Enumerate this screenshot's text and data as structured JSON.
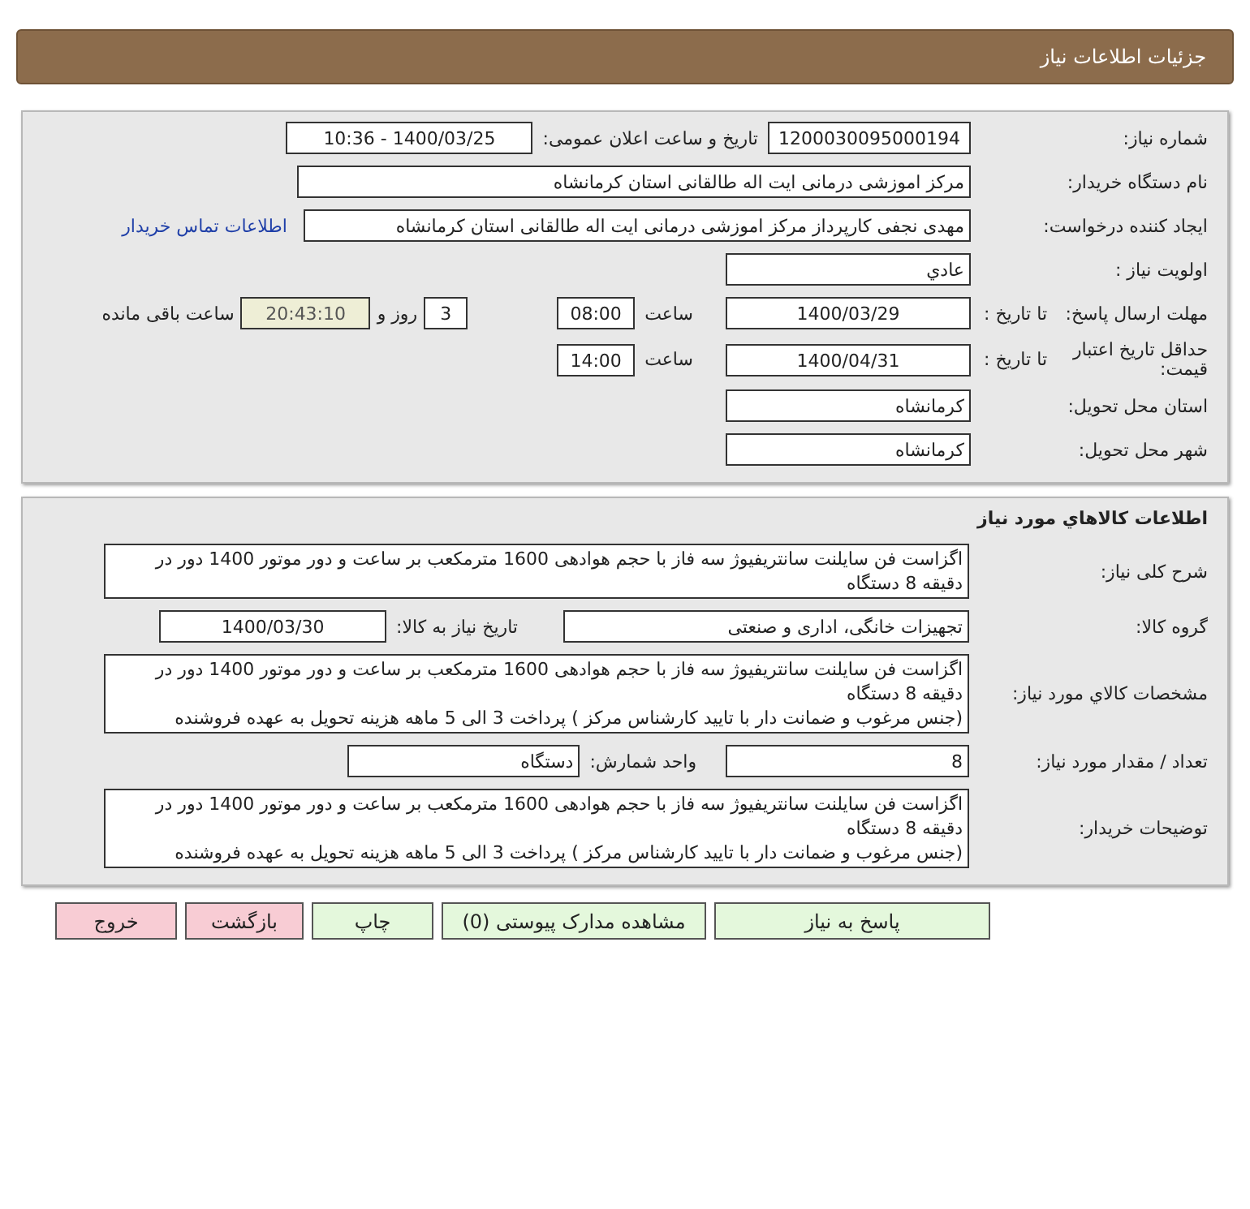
{
  "header": {
    "title": "جزئیات اطلاعات نیاز"
  },
  "need_info": {
    "need_number": {
      "label": "شماره نیاز:",
      "value": "1200030095000194"
    },
    "announce": {
      "label": "تاریخ و ساعت اعلان عمومی:",
      "value": "1400/03/25 - 10:36"
    },
    "buyer_org": {
      "label": "نام دستگاه خریدار:",
      "value": "مرکز اموزشی درمانی ایت اله طالقانی استان کرمانشاه"
    },
    "requester": {
      "label": "ایجاد کننده درخواست:",
      "value": "مهدی نجفی کارپرداز مرکز اموزشی درمانی ایت اله طالقانی استان کرمانشاه",
      "link": "اطلاعات تماس خریدار"
    },
    "priority": {
      "label": "اولویت نیاز :",
      "value": "عادي"
    },
    "deadline": {
      "label": "مهلت ارسال پاسخ:",
      "to_label": "تا تاریخ :",
      "date": "1400/03/29",
      "time_label": "ساعت",
      "time": "08:00",
      "days": "3",
      "days_label": "روز و",
      "remaining": "20:43:10",
      "remaining_label": "ساعت باقی مانده"
    },
    "validity": {
      "label": "حداقل تاریخ اعتبار قیمت:",
      "to_label": "تا تاریخ :",
      "date": "1400/04/31",
      "time_label": "ساعت",
      "time": "14:00"
    },
    "province": {
      "label": "استان محل تحویل:",
      "value": "کرمانشاه"
    },
    "city": {
      "label": "شهر محل تحویل:",
      "value": "کرمانشاه"
    }
  },
  "goods": {
    "title": "اطلاعات کالاهاي مورد نياز",
    "description": {
      "label": "شرح کلی نیاز:",
      "lines": [
        "اگزاست فن سایلنت سانتریفیوژ سه فاز با حجم هوادهی 1600 مترمکعب بر ساعت و دور موتور 1400 دور در دقیقه  8 دستگاه"
      ]
    },
    "group": {
      "label": "گروه کالا:",
      "value": "تجهیزات خانگی، اداری و صنعتی",
      "date_label": "تاریخ نیاز به کالا:",
      "date": "1400/03/30"
    },
    "specs": {
      "label": "مشخصات کالاي مورد نياز:",
      "lines": [
        "اگزاست فن سایلنت سانتریفیوژ سه فاز با حجم هوادهی 1600 مترمکعب بر ساعت و دور موتور 1400 دور در دقیقه  8 دستگاه",
        "(جنس مرغوب و ضمانت دار با تایید کارشناس مرکز ) پرداخت 3 الی 5 ماهه هزینه تحویل به عهده فروشنده"
      ]
    },
    "quantity": {
      "label": "تعداد / مقدار مورد نیاز:",
      "value": "8",
      "unit_label": "واحد شمارش:",
      "unit": "دستگاه"
    },
    "buyer_notes": {
      "label": "توضیحات خریدار:",
      "lines": [
        "اگزاست فن سایلنت سانتریفیوژ سه فاز با حجم هوادهی 1600 مترمکعب بر ساعت و دور موتور 1400 دور در دقیقه  8 دستگاه",
        "(جنس مرغوب و ضمانت دار با تایید کارشناس مرکز ) پرداخت 3 الی 5 ماهه هزینه تحویل به عهده فروشنده"
      ]
    }
  },
  "buttons": [
    {
      "label": "پاسخ به نیاز",
      "kind": "action"
    },
    {
      "label": "مشاهده مدارک پیوستی (0)",
      "kind": "action"
    },
    {
      "label": "چاپ",
      "kind": "action"
    },
    {
      "label": "بازگشت",
      "kind": "exit"
    },
    {
      "label": "خروج",
      "kind": "exit"
    }
  ]
}
